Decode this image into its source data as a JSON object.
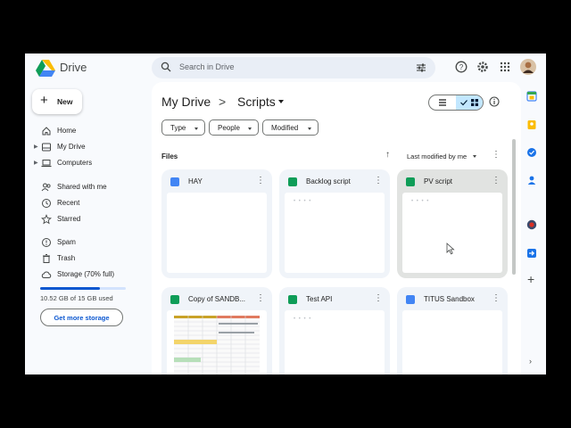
{
  "app": {
    "brand": "Drive"
  },
  "search": {
    "placeholder": "Search in Drive"
  },
  "new_button": {
    "label": "New"
  },
  "nav": [
    {
      "label": "Home",
      "icon": "home-icon"
    },
    {
      "label": "My Drive",
      "icon": "my-drive-icon"
    },
    {
      "label": "Computers",
      "icon": "computers-icon"
    },
    {
      "label": "Shared with me",
      "icon": "shared-icon"
    },
    {
      "label": "Recent",
      "icon": "clock-icon"
    },
    {
      "label": "Starred",
      "icon": "star-icon"
    },
    {
      "label": "Spam",
      "icon": "spam-icon"
    },
    {
      "label": "Trash",
      "icon": "trash-icon"
    },
    {
      "label": "Storage (70% full)",
      "icon": "cloud-icon"
    }
  ],
  "storage": {
    "used_text": "10.52 GB of 15 GB used",
    "fraction": 0.7,
    "cta": "Get more storage"
  },
  "breadcrumb": {
    "root": "My Drive",
    "separator": ">",
    "current": "Scripts"
  },
  "filters": [
    "Type",
    "People",
    "Modified"
  ],
  "files": {
    "heading": "Files",
    "sort_label": "Last modified by me"
  },
  "cards": [
    {
      "name": "HAY",
      "type": "doc"
    },
    {
      "name": "Backlog script",
      "type": "sheet"
    },
    {
      "name": "PV script",
      "type": "sheet"
    },
    {
      "name": "Copy of SANDB...",
      "type": "sheet"
    },
    {
      "name": "Test API",
      "type": "sheet"
    },
    {
      "name": "TITUS Sandbox",
      "type": "doc"
    }
  ],
  "colors": {
    "accent": "#0b57d0",
    "doc_blue": "#4285f4",
    "sheet_green": "#0f9d58",
    "selected_bg": "#c2e7ff"
  }
}
